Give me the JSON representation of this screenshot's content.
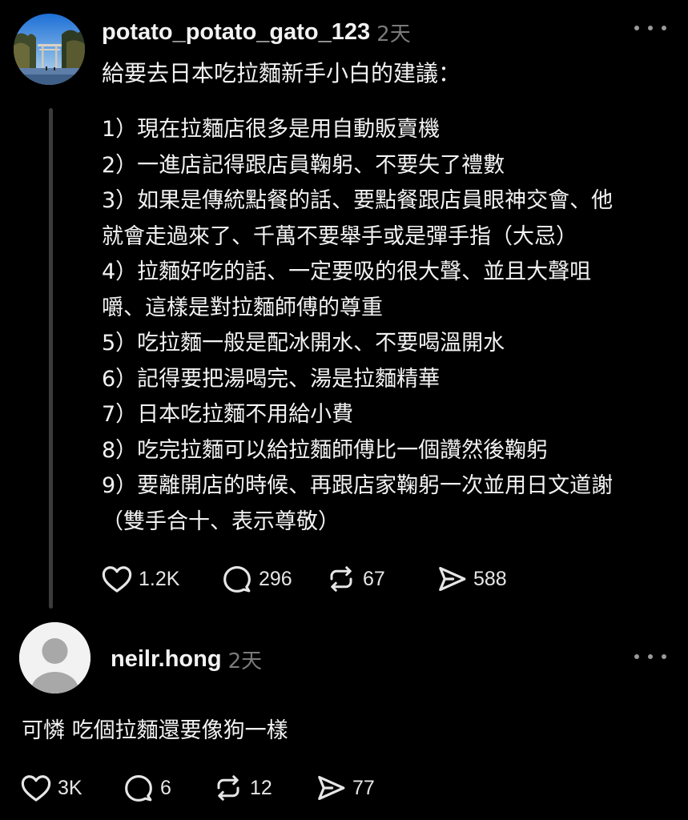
{
  "post1": {
    "username": "potato_potato_gato_123",
    "timestamp": "2天",
    "intro": "給要去日本吃拉麵新手小白的建議：",
    "lines": [
      "1）現在拉麵店很多是用自動販賣機",
      "2）一進店記得跟店員鞠躬、不要失了禮數",
      "3）如果是傳統點餐的話、要點餐跟店員眼神交會、他",
      "就會走過來了、千萬不要舉手或是彈手指（大忌）",
      "4）拉麵好吃的話、一定要吸的很大聲、並且大聲咀",
      "嚼、這樣是對拉麵師傅的尊重",
      "5）吃拉麵一般是配冰開水、不要喝溫開水",
      "6）記得要把湯喝完、湯是拉麵精華",
      "7）日本吃拉麵不用給小費",
      "8）吃完拉麵可以給拉麵師傅比一個讚然後鞠躬",
      "9）要離開店的時候、再跟店家鞠躬一次並用日文道謝",
      "（雙手合十、表示尊敬）"
    ],
    "likes": "1.2K",
    "comments": "296",
    "reposts": "67",
    "shares": "588"
  },
  "post2": {
    "username": "neilr.hong",
    "timestamp": "2天",
    "text": "可憐 吃個拉麵還要像狗一樣",
    "likes": "3K",
    "comments": "6",
    "reposts": "12",
    "shares": "77"
  },
  "icons": {
    "more": "more-horizontal-icon",
    "like": "heart-icon",
    "comment": "comment-bubble-icon",
    "repost": "repost-icon",
    "share": "send-icon"
  },
  "colors": {
    "background": "#000000",
    "text": "#f2f2f2",
    "muted": "#7a7a7a",
    "thread_line": "#3b3b3b"
  }
}
